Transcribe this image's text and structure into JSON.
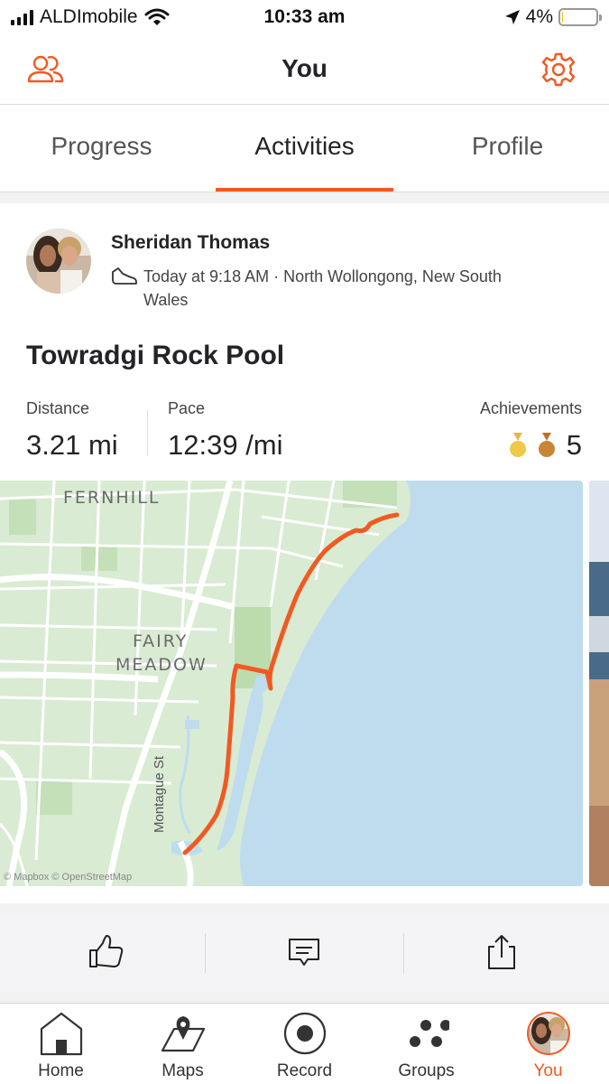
{
  "status_bar": {
    "carrier": "ALDImobile",
    "time": "10:33 am",
    "battery": "4%",
    "battery_level": 0.04
  },
  "header": {
    "title": "You",
    "left_icon": "people-icon",
    "right_icon": "gear-icon"
  },
  "tabs": [
    {
      "label": "Progress",
      "active": false
    },
    {
      "label": "Activities",
      "active": true
    },
    {
      "label": "Profile",
      "active": false
    }
  ],
  "activity": {
    "athlete": "Sheridan Thomas",
    "meta": "Today at 9:18 AM · North Wollongong, New South Wales",
    "title": "Towradgi Rock Pool",
    "stats": {
      "distance_label": "Distance",
      "distance": "3.21 mi",
      "pace_label": "Pace",
      "pace": "12:39 /mi",
      "achievements_label": "Achievements",
      "achievements": "5"
    },
    "map": {
      "labels": {
        "fernhill": "FERNHILL",
        "fairy": "FAIRY",
        "meadow": "MEADOW",
        "street": "Montague St"
      },
      "attribution": "© Mapbox © OpenStreetMap",
      "route_color": "#f05a22",
      "water_color": "#bfdcee",
      "land_color": "#d9ebd3"
    }
  },
  "actions": [
    "thumbs-up-icon",
    "comment-icon",
    "share-icon"
  ],
  "nav": [
    {
      "label": "Home",
      "icon": "home-icon",
      "active": false
    },
    {
      "label": "Maps",
      "icon": "map-icon",
      "active": false
    },
    {
      "label": "Record",
      "icon": "record-icon",
      "active": false
    },
    {
      "label": "Groups",
      "icon": "groups-icon",
      "active": false
    },
    {
      "label": "You",
      "icon": "avatar",
      "active": true
    }
  ],
  "colors": {
    "accent": "#f05a22",
    "text": "#242428"
  }
}
